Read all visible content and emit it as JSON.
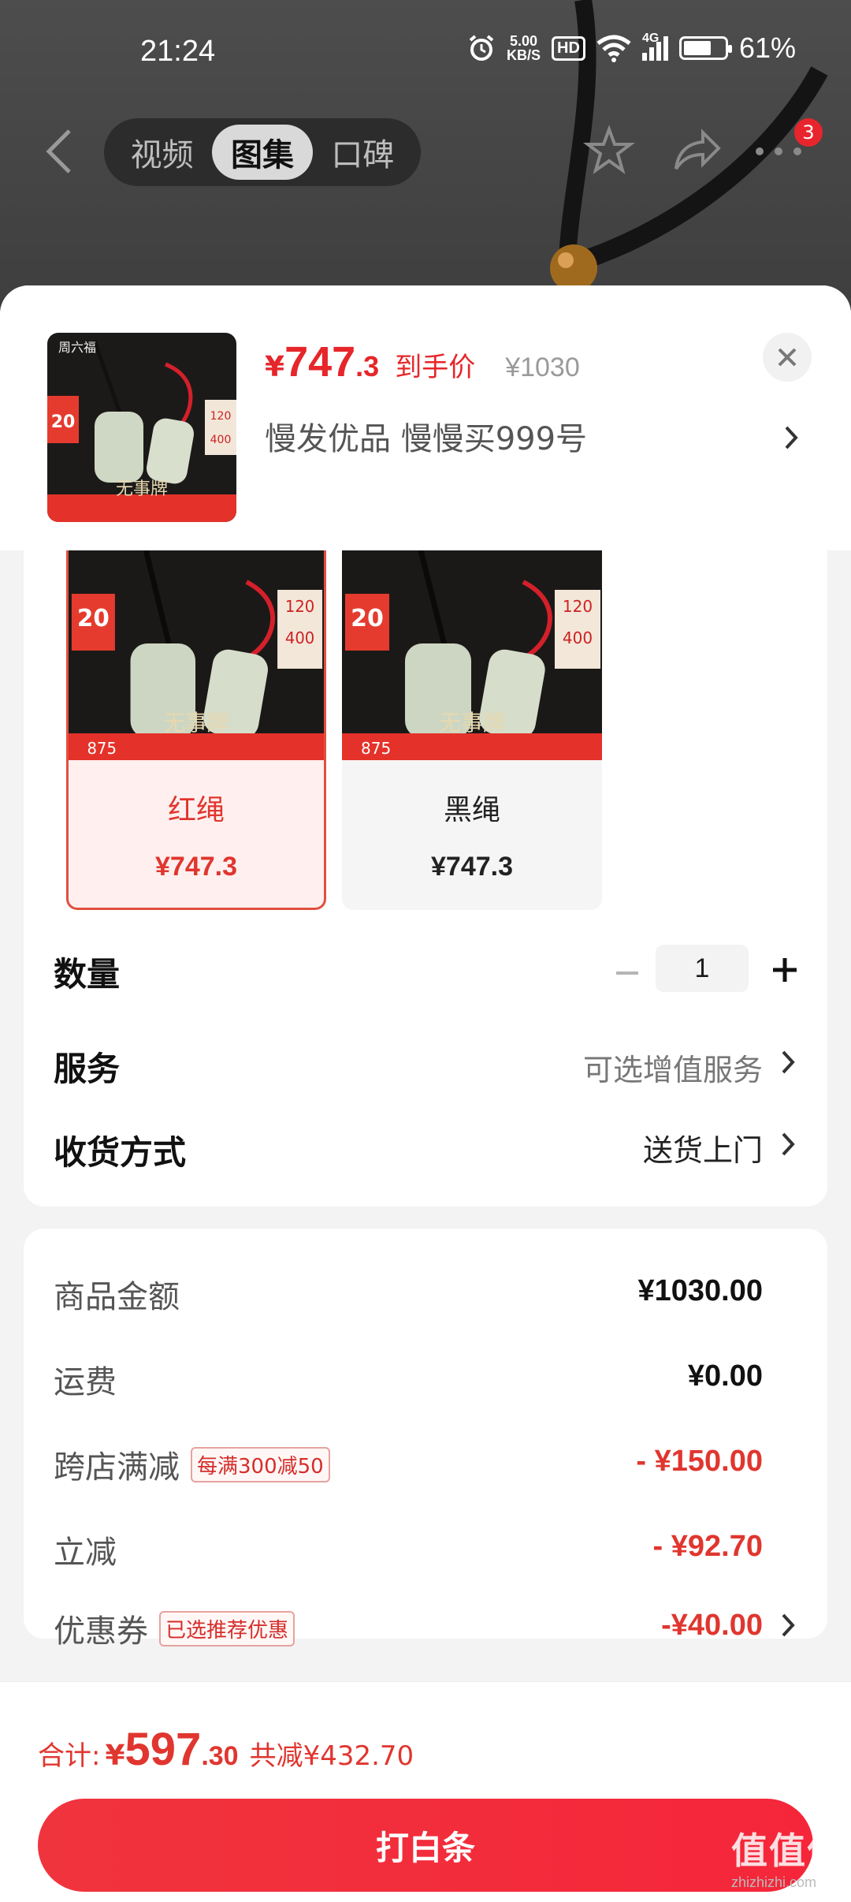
{
  "status_bar": {
    "time": "21:24",
    "speed_value": "5.00",
    "speed_unit": "KB/S",
    "hd": "HD",
    "network": "4G",
    "battery": "61%"
  },
  "nav": {
    "tabs": [
      {
        "label": "视频",
        "active": false
      },
      {
        "label": "图集",
        "active": true
      },
      {
        "label": "口碑",
        "active": false
      }
    ],
    "cart_badge": "3"
  },
  "product": {
    "price_yen": "¥",
    "price_int": "747",
    "price_dec": ".3",
    "price_tag": "到手价",
    "original_price": "¥1030",
    "shop_line": "慢发优品  慢慢买999号",
    "thumb_brand": "周六福",
    "thumb_title": "无事牌"
  },
  "variants": [
    {
      "name": "红绳",
      "price": "¥747.3",
      "selected": true,
      "image_title": "无事牌"
    },
    {
      "name": "黑绳",
      "price": "¥747.3",
      "selected": false,
      "image_title": "无事牌"
    }
  ],
  "options": {
    "quantity_label": "数量",
    "quantity_value": "1",
    "service_label": "服务",
    "service_value": "可选增值服务",
    "delivery_label": "收货方式",
    "delivery_value": "送货上门"
  },
  "summary": {
    "rows": [
      {
        "label": "商品金额",
        "value": "¥1030.00",
        "tag": ""
      },
      {
        "label": "运费",
        "value": "¥0.00",
        "tag": ""
      },
      {
        "label": "跨店满减",
        "value": "- ¥150.00",
        "tag": "每满300减50"
      },
      {
        "label": "立减",
        "value": "- ¥92.70",
        "tag": ""
      },
      {
        "label": "优惠券",
        "value": "-¥40.00",
        "tag": "已选推荐优惠"
      }
    ]
  },
  "footer": {
    "total_label": "合计:",
    "total_yen": "¥",
    "total_int": "597",
    "total_dec": ".30",
    "total_saved": "共减¥432.70",
    "pay_label": "打白条",
    "watermark": "值值值",
    "watermark_url": "zhizhizhi.com"
  },
  "colors": {
    "accent_red": "#e0362f",
    "button_red": "#f0343d"
  }
}
